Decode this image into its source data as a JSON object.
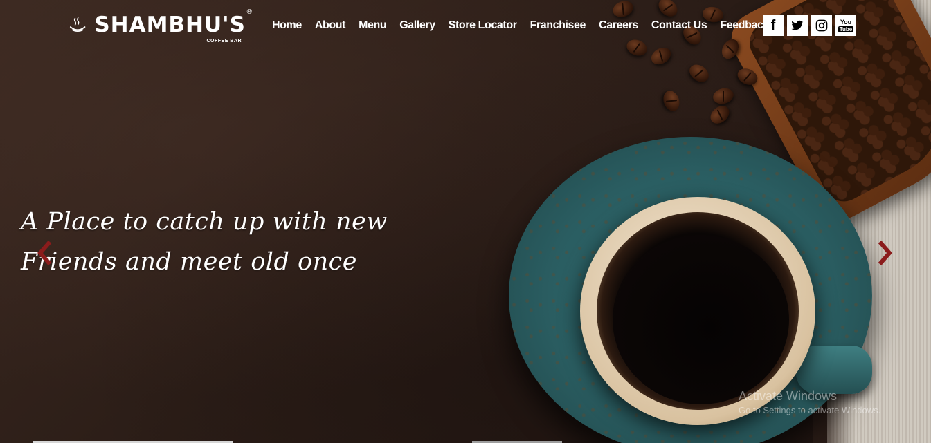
{
  "brand": {
    "name": "SHAMBHU'S",
    "registered": "®",
    "subtitle": "COFFEE BAR"
  },
  "nav": {
    "items": [
      "Home",
      "About",
      "Menu",
      "Gallery",
      "Store Locator",
      "Franchisee",
      "Careers",
      "Contact Us",
      "Feedback"
    ]
  },
  "social": {
    "facebook": "f",
    "youtube_top": "You",
    "youtube_bottom": "Tube",
    "icons": [
      "facebook-icon",
      "twitter-icon",
      "instagram-icon",
      "youtube-icon"
    ]
  },
  "slider": {
    "caption_line1": "A Place to catch up with new",
    "caption_line2": "Friends and meet old once",
    "arrow_color": "#8b1c1c"
  },
  "watermark": {
    "title": "Activate Windows",
    "subtitle": "Go to Settings to activate Windows."
  }
}
